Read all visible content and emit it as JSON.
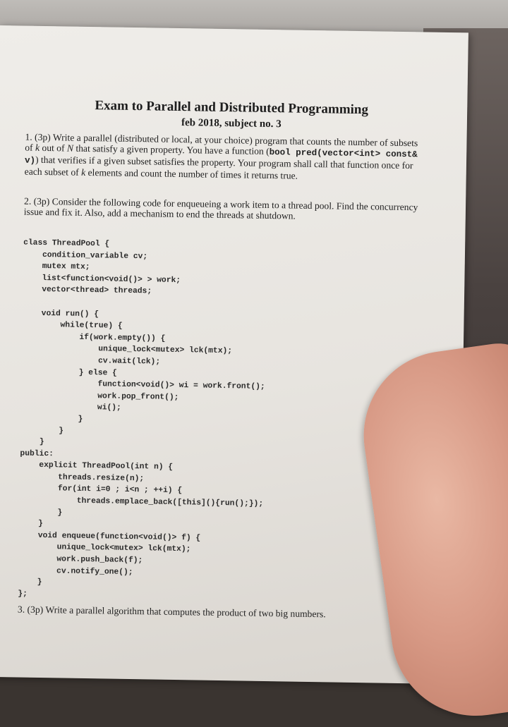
{
  "title": "Exam to Parallel and Distributed Programming",
  "subtitle": "feb 2018, subject no. 3",
  "q1": {
    "a": "1. (3p) Write a parallel (distributed or local, at your choice) program that counts the number of subsets of ",
    "k": "k",
    "b": " out of ",
    "n": "N",
    "c": " that satisfy a given property. You have a function (",
    "code": "bool pred(vector<int> const& v)",
    "d": ") that verifies if a given subset satisfies the property. Your program shall call that function once for each subset of ",
    "k2": "k",
    "e": " elements and count the number of times it returns true."
  },
  "q2": "2. (3p) Consider the following code for enqueueing a work item to a thread pool. Find the concurrency issue and fix it. Also, add a mechanism to end the threads at shutdown.",
  "code_lines": [
    "class ThreadPool {",
    "    condition_variable cv;",
    "    mutex mtx;",
    "    list<function<void()> > work;",
    "    vector<thread> threads;",
    "",
    "    void run() {",
    "        while(true) {",
    "            if(work.empty()) {",
    "                unique_lock<mutex> lck(mtx);",
    "                cv.wait(lck);",
    "            } else {",
    "                function<void()> wi = work.front();",
    "                work.pop_front();",
    "                wi();",
    "            }",
    "        }",
    "    }",
    "public:",
    "    explicit ThreadPool(int n) {",
    "        threads.resize(n);",
    "        for(int i=0 ; i<n ; ++i) {",
    "            threads.emplace_back([this](){run();});",
    "        }",
    "    }",
    "    void enqueue(function<void()> f) {",
    "        unique_lock<mutex> lck(mtx);",
    "        work.push_back(f);",
    "        cv.notify_one();",
    "    }",
    "};"
  ],
  "q3": "3. (3p) Write a parallel algorithm that computes the product of two big numbers."
}
